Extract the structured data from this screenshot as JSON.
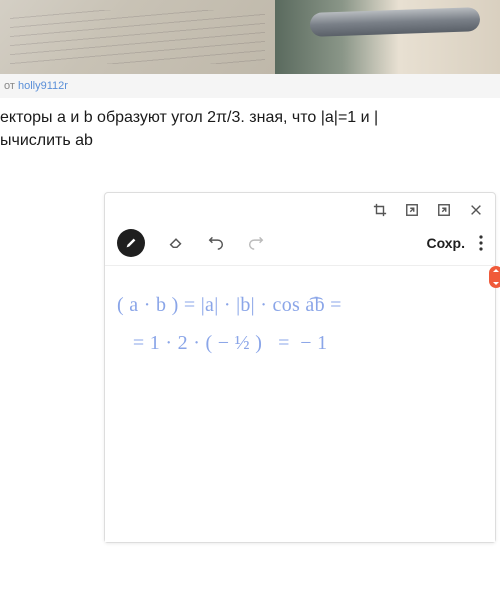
{
  "byline": {
    "prefix": "от ",
    "username": "holly9112r"
  },
  "question": {
    "line1": "екторы a и b образуют угол 2π/3. зная, что |a|=1 и |",
    "line2": "ычислить ab"
  },
  "editor": {
    "save_label": "Сохр."
  },
  "handwriting": {
    "line1": "( a · b ) = |a| · |b| · cos a͡b =",
    "line2": "   = 1 · 2 · ( − ½ )   =  − 1"
  }
}
